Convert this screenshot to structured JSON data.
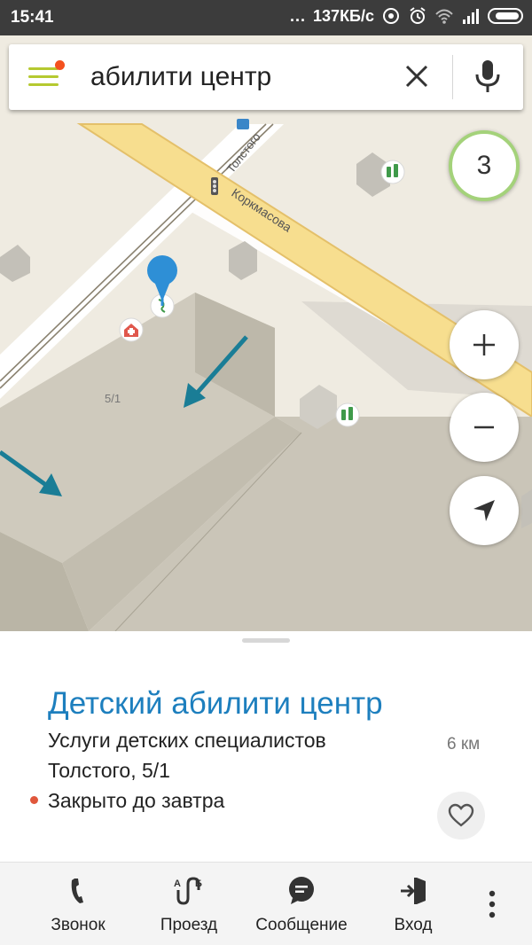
{
  "status_bar": {
    "time": "15:41",
    "dots": "...",
    "network_speed": "137КБ/с",
    "icons": [
      "sync-icon",
      "alarm-icon",
      "wifi-icon",
      "signal-icon",
      "battery-icon"
    ]
  },
  "search": {
    "query": "абилити центр",
    "menu_icon": "hamburger-menu-icon",
    "clear_icon": "close-icon",
    "voice_icon": "microphone-icon"
  },
  "map": {
    "street_labels": [
      "Толстого",
      "Коркмасова"
    ],
    "building_label": "5/1",
    "zoom_badge": "3",
    "controls": [
      "zoom-in-icon",
      "zoom-out-icon",
      "my-location-icon"
    ],
    "colors": {
      "background": "#efebe1",
      "main_road": "#f7de8f",
      "road_edge": "#e4c06a",
      "building": "#c9c4b6",
      "marker": "#2e8fd6",
      "arrow": "#1a7d96"
    }
  },
  "place": {
    "title": "Детский абилити центр",
    "category": "Услуги детских специалистов",
    "address": "Толстого, 5/1",
    "status": "Закрыто до завтра",
    "distance": "6 км",
    "favorite_icon": "heart-icon"
  },
  "actions": [
    {
      "label": "Звонок",
      "icon": "phone-icon"
    },
    {
      "label": "Проезд",
      "icon": "route-icon"
    },
    {
      "label": "Сообщение",
      "icon": "message-icon"
    },
    {
      "label": "Вход",
      "icon": "entrance-icon"
    }
  ]
}
